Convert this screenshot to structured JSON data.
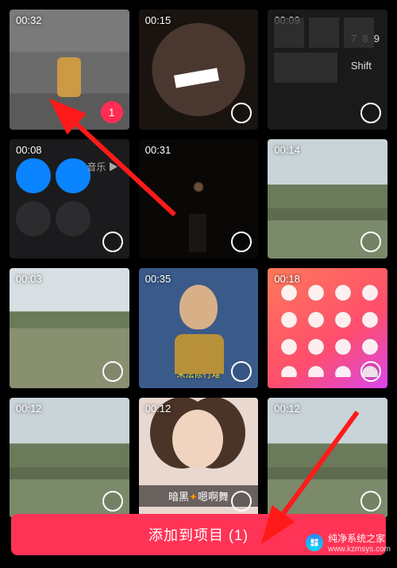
{
  "videos": [
    {
      "duration": "00:32",
      "selected": true,
      "order": "1",
      "kind": "game"
    },
    {
      "duration": "00:15",
      "selected": false,
      "kind": "record"
    },
    {
      "duration": "00:09",
      "selected": false,
      "kind": "keyboard"
    },
    {
      "duration": "00:08",
      "selected": false,
      "kind": "control"
    },
    {
      "duration": "00:31",
      "selected": false,
      "kind": "fireworks"
    },
    {
      "duration": "00:14",
      "selected": false,
      "kind": "mountain"
    },
    {
      "duration": "00:03",
      "selected": false,
      "kind": "water"
    },
    {
      "duration": "00:35",
      "selected": false,
      "kind": "monk",
      "caption": "末法修行难"
    },
    {
      "duration": "00:18",
      "selected": false,
      "kind": "home"
    },
    {
      "duration": "00:12",
      "selected": false,
      "kind": "mountain"
    },
    {
      "duration": "00:12",
      "selected": false,
      "kind": "girl",
      "caption_pre": "暗黑",
      "caption_spark": "✦",
      "caption_post": "嗯啊舞"
    },
    {
      "duration": "00:12",
      "selected": false,
      "kind": "mountain"
    }
  ],
  "add_button": "添加到项目 (1)",
  "watermark": {
    "title": "纯净系统之家",
    "url": "www.kzmsys.com"
  }
}
